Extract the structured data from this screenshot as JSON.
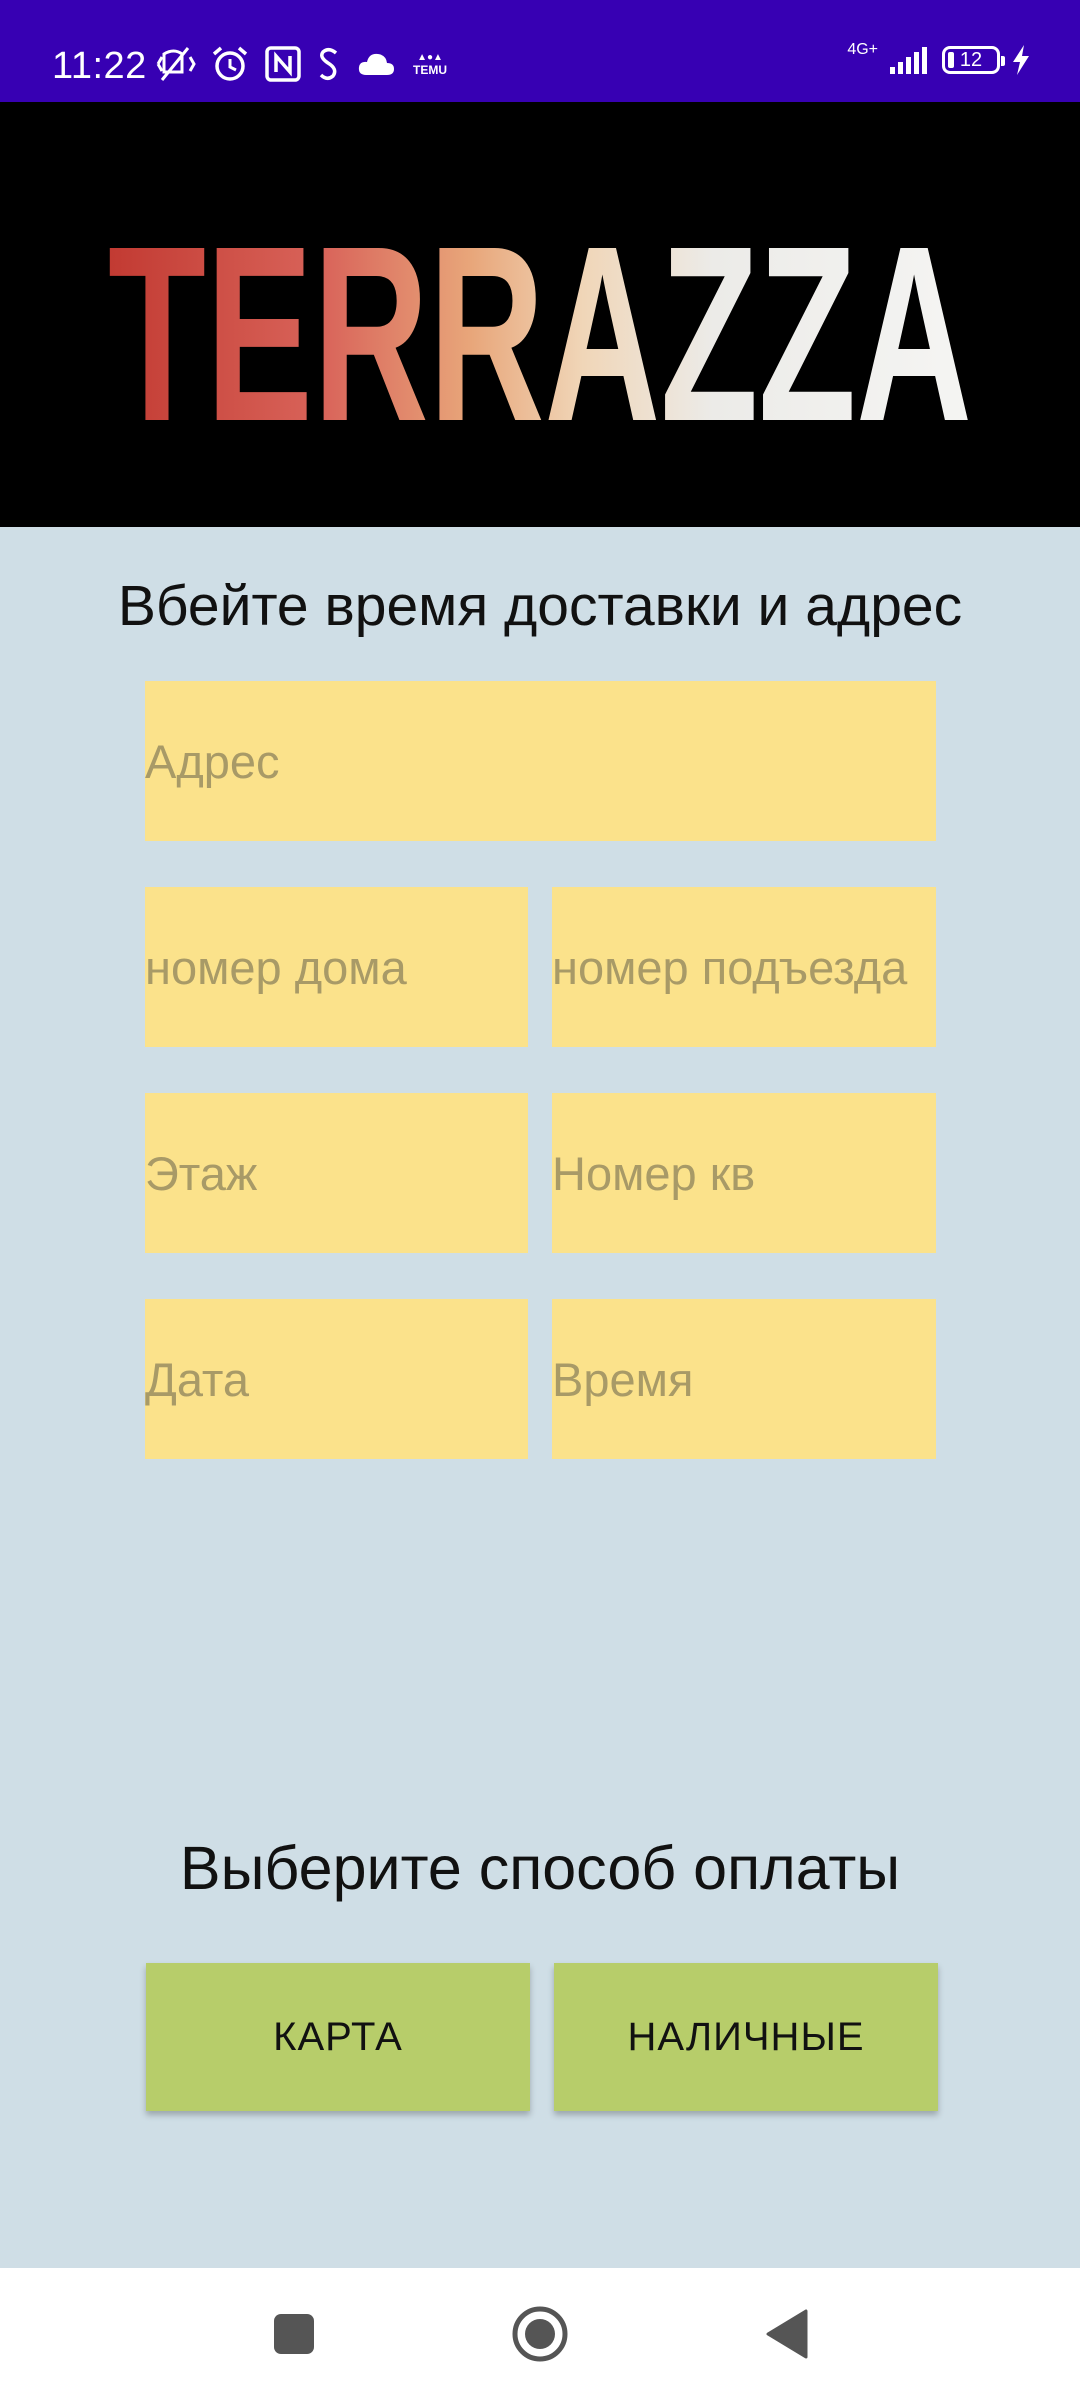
{
  "status_bar": {
    "time": "11:22",
    "temu_label": "TEMU",
    "network_label": "4G+",
    "battery_level": "12",
    "background_color": "#3700b3",
    "icons": [
      "mute-vibrate-icon",
      "alarm-icon",
      "nfc-icon",
      "sim-icon",
      "cloud-icon",
      "temu-icon",
      "signal-icon",
      "battery-icon",
      "charging-icon"
    ]
  },
  "header": {
    "logo_text": "TERRAZZA"
  },
  "delivery": {
    "heading": "Вбейте время доставки и адрес",
    "address_placeholder": "Адрес",
    "house_number_placeholder": "номер дома",
    "entrance_number_placeholder": "номер подъезда",
    "floor_placeholder": "Этаж",
    "apartment_placeholder": "Номер кв",
    "date_placeholder": "Дата",
    "time_placeholder": "Время",
    "field_color": "#fbe28b"
  },
  "payment": {
    "heading": "Выберите способ оплаты",
    "card_label": "КАРТА",
    "cash_label": "НАЛИЧНЫЕ",
    "button_color": "#b7cd6a"
  },
  "navigation": {
    "icons": [
      "recent-apps-icon",
      "home-icon",
      "back-icon"
    ]
  },
  "theme": {
    "background": "#cfdee6"
  }
}
